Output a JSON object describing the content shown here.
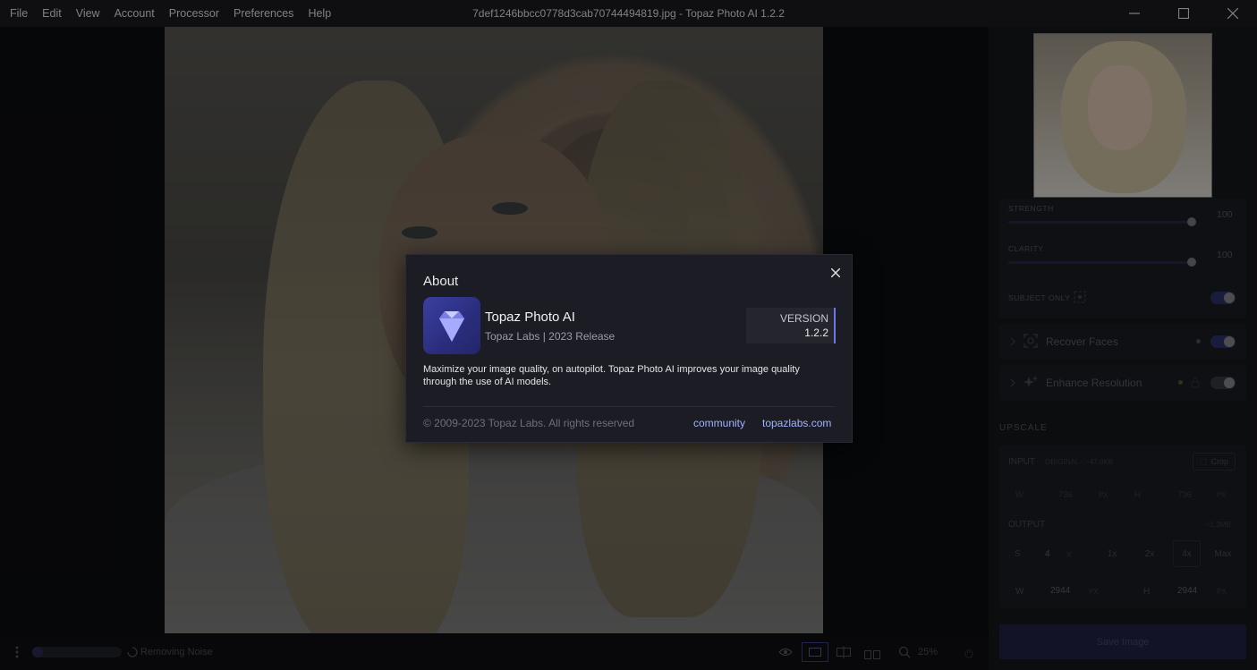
{
  "menu": {
    "items": [
      "File",
      "Edit",
      "View",
      "Account",
      "Processor",
      "Preferences",
      "Help"
    ]
  },
  "window": {
    "title": "7def1246bbcc0778d3cab70744494819.jpg - Topaz Photo AI 1.2.2",
    "minimize_icon": "minimize-icon",
    "maximize_icon": "maximize-icon",
    "close_icon": "close-icon"
  },
  "panel": {
    "strength_label": "STRENGTH",
    "strength_value": "100",
    "clarity_label": "CLARITY",
    "clarity_value": "100",
    "subject_only_label": "SUBJECT ONLY",
    "recover_faces_label": "Recover Faces",
    "enhance_resolution_label": "Enhance Resolution",
    "upscale_header": "UPSCALE",
    "input_label": "INPUT",
    "input_detail": "ORIGINAL · ~47.0KB",
    "crop_label": "Crop",
    "in_w_label": "W",
    "in_w_value": "736",
    "in_w_unit": "PX",
    "in_h_label": "H",
    "in_h_value": "736",
    "in_h_unit": "PX",
    "output_label": "OUTPUT",
    "output_size": "~1.3MB",
    "scale_label": "S",
    "scale_value": "4",
    "scale_unit": "X",
    "scale_options": [
      "1x",
      "2x",
      "4x",
      "Max"
    ],
    "out_w_label": "W",
    "out_w_value": "2944",
    "out_w_unit": "PX",
    "out_h_label": "H",
    "out_h_value": "2944",
    "out_h_unit": "PX",
    "save_label": "Save Image"
  },
  "bottombar": {
    "status": "Removing Noise",
    "progress": 0.12,
    "zoom": "25%"
  },
  "about": {
    "title": "About",
    "app_name": "Topaz Photo AI",
    "app_sub": "Topaz Labs | 2023 Release",
    "version_label": "VERSION",
    "version_number": "1.2.2",
    "description": "Maximize your image quality, on autopilot. Topaz Photo AI improves your image quality through the use of AI models.",
    "copyright": "© 2009-2023 Topaz Labs. All rights reserved",
    "link_community": "community",
    "link_site": "topazlabs.com"
  },
  "colors": {
    "accent": "#6e73e8",
    "link": "#9fb4ff"
  }
}
